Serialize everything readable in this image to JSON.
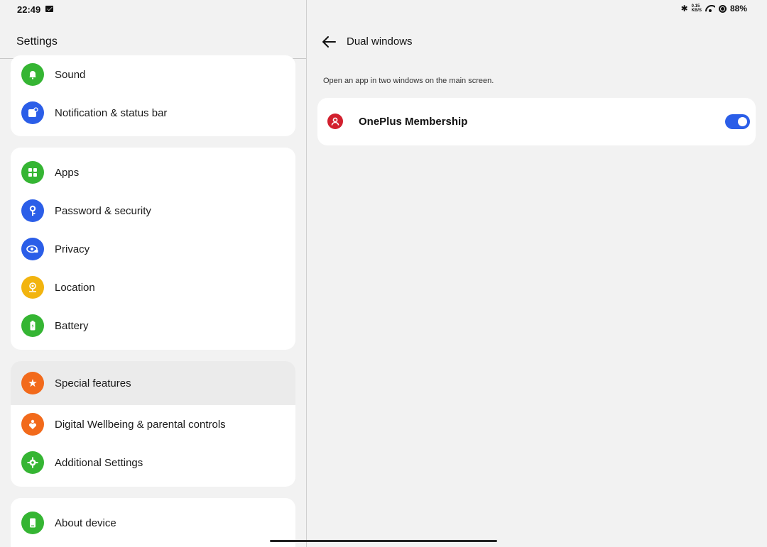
{
  "status_bar": {
    "time": "22:49",
    "net_speed_value": "0.15",
    "net_speed_unit": "KB/S",
    "battery": "88%"
  },
  "left": {
    "title": "Settings",
    "groups": [
      {
        "items": [
          {
            "label": "Sound",
            "icon": "bell-icon",
            "color": "#35b533"
          },
          {
            "label": "Notification & status bar",
            "icon": "notification-icon",
            "color": "#2b5ee8"
          }
        ]
      },
      {
        "items": [
          {
            "label": "Apps",
            "icon": "apps-grid-icon",
            "color": "#35b533"
          },
          {
            "label": "Password & security",
            "icon": "key-icon",
            "color": "#2b5ee8"
          },
          {
            "label": "Privacy",
            "icon": "eye-lock-icon",
            "color": "#2b5ee8"
          },
          {
            "label": "Location",
            "icon": "location-pin-icon",
            "color": "#f2b40f"
          },
          {
            "label": "Battery",
            "icon": "battery-charging-icon",
            "color": "#35b533"
          }
        ]
      },
      {
        "items": [
          {
            "label": "Special features",
            "icon": "star-icon",
            "color": "#f26a1b",
            "selected": true
          },
          {
            "label": "Digital Wellbeing & parental controls",
            "icon": "heart-person-icon",
            "color": "#f26a1b"
          },
          {
            "label": "Additional Settings",
            "icon": "gear-icon",
            "color": "#35b533"
          }
        ]
      },
      {
        "items": [
          {
            "label": "About device",
            "icon": "phone-icon",
            "color": "#35b533"
          }
        ]
      }
    ]
  },
  "right": {
    "title": "Dual windows",
    "description": "Open an app in two windows on the main screen.",
    "apps": [
      {
        "label": "OnePlus Membership",
        "icon": "membership-person-icon",
        "enabled": true
      }
    ]
  },
  "colors": {
    "accent": "#2b5ee8",
    "membership": "#d2202e"
  }
}
